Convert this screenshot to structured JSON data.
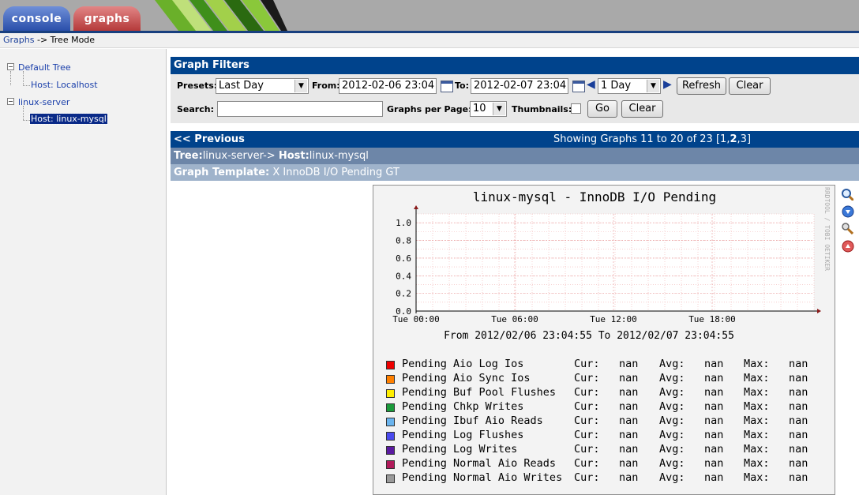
{
  "tabs": [
    {
      "label": "console"
    },
    {
      "label": "graphs"
    }
  ],
  "breadcrumb": {
    "link": "Graphs",
    "rest": "-> Tree Mode"
  },
  "tree": {
    "items": [
      {
        "label": "Default Tree",
        "box": "−"
      },
      {
        "label": "Host: Localhost"
      },
      {
        "label": "linux-server",
        "box": "−"
      },
      {
        "label": "Host: linux-mysql"
      }
    ]
  },
  "filters": {
    "title": "Graph Filters",
    "presets_label": "Presets:",
    "presets_value": "Last Day",
    "from_label": "From:",
    "from_value": "2012-02-06 23:04",
    "to_label": "To:",
    "to_value": "2012-02-07 23:04",
    "span_value": "1 Day",
    "refresh_label": "Refresh",
    "clear_label": "Clear",
    "search_label": "Search:",
    "search_value": "",
    "gpp_label": "Graphs per Page:",
    "gpp_value": "10",
    "thumbs_label": "Thumbnails:",
    "go_label": "Go",
    "clear2_label": "Clear"
  },
  "nav": {
    "previous": "<< Previous",
    "showing": "Showing Graphs 11 to 20 of 23 [",
    "pages": [
      "1",
      "2",
      "3"
    ],
    "close": "]"
  },
  "row_tree": {
    "tree_label": "Tree:",
    "tree_value": "linux-server->",
    "host_label": "Host:",
    "host_value": "linux-mysql"
  },
  "row_template": {
    "label": "Graph Template:",
    "value": "X InnoDB I/O Pending GT"
  },
  "graph": {
    "title": "linux-mysql - InnoDB I/O Pending",
    "subtitle": "From 2012/02/06 23:04:55 To 2012/02/07 23:04:55",
    "watermark": "RRDTOOL / TOBI OETIKER",
    "legend_labels": {
      "cur": "Cur:",
      "avg": "Avg:",
      "max": "Max:"
    }
  },
  "chart_data": {
    "type": "line",
    "title": "linux-mysql - InnoDB I/O Pending",
    "subtitle": "From 2012/02/06 23:04:55 To 2012/02/07 23:04:55",
    "xlabel": "",
    "ylabel": "",
    "ylim": [
      0,
      1.1
    ],
    "yticks": [
      "0.0",
      "0.2",
      "0.4",
      "0.6",
      "0.8",
      "1.0"
    ],
    "xticks": [
      "Tue 00:00",
      "Tue 06:00",
      "Tue 12:00",
      "Tue 18:00"
    ],
    "grid": true,
    "series": [
      {
        "name": "Pending Aio Log Ios",
        "color": "#ee0000",
        "cur": "nan",
        "avg": "nan",
        "max": "nan"
      },
      {
        "name": "Pending Aio Sync Ios",
        "color": "#ff8000",
        "cur": "nan",
        "avg": "nan",
        "max": "nan"
      },
      {
        "name": "Pending Buf Pool Flushes",
        "color": "#ffee00",
        "cur": "nan",
        "avg": "nan",
        "max": "nan"
      },
      {
        "name": "Pending Chkp Writes",
        "color": "#1a9a3a",
        "cur": "nan",
        "avg": "nan",
        "max": "nan"
      },
      {
        "name": "Pending Ibuf Aio Reads",
        "color": "#6ab4ee",
        "cur": "nan",
        "avg": "nan",
        "max": "nan"
      },
      {
        "name": "Pending Log Flushes",
        "color": "#4a4aee",
        "cur": "nan",
        "avg": "nan",
        "max": "nan"
      },
      {
        "name": "Pending Log Writes",
        "color": "#5a1aa0",
        "cur": "nan",
        "avg": "nan",
        "max": "nan"
      },
      {
        "name": "Pending Normal Aio Reads",
        "color": "#b01a5a",
        "cur": "nan",
        "avg": "nan",
        "max": "nan"
      },
      {
        "name": "Pending Normal Aio Writes",
        "color": "#9a9a9a",
        "cur": "nan",
        "avg": "nan",
        "max": "nan"
      }
    ]
  },
  "side_icons": [
    "zoom-icon",
    "download-icon",
    "edit-icon",
    "remove-icon"
  ]
}
